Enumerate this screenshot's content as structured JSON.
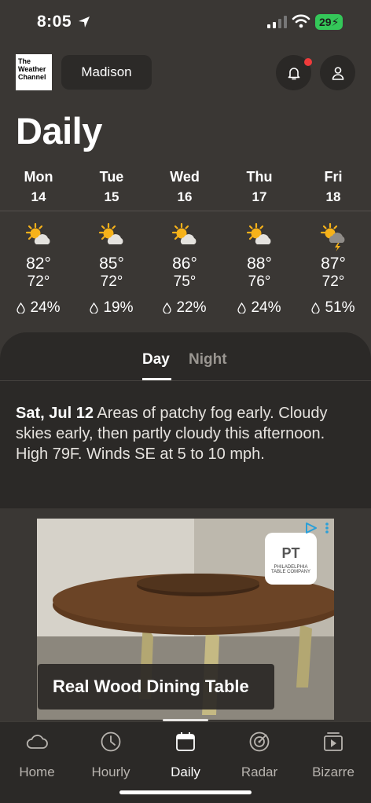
{
  "status_bar": {
    "time": "8:05",
    "battery": "29"
  },
  "header": {
    "logo_lines": [
      "The",
      "Weather",
      "Channel"
    ],
    "location": "Madison",
    "title": "Daily"
  },
  "days": [
    {
      "name": "Mon",
      "date": "14",
      "high": "82°",
      "low": "72°",
      "precip": "24%",
      "icon": "partly-sunny-icon"
    },
    {
      "name": "Tue",
      "date": "15",
      "high": "85°",
      "low": "72°",
      "precip": "19%",
      "icon": "partly-sunny-icon"
    },
    {
      "name": "Wed",
      "date": "16",
      "high": "86°",
      "low": "75°",
      "precip": "22%",
      "icon": "partly-sunny-icon"
    },
    {
      "name": "Thu",
      "date": "17",
      "high": "88°",
      "low": "76°",
      "precip": "24%",
      "icon": "partly-sunny-icon"
    },
    {
      "name": "Fri",
      "date": "18",
      "high": "87°",
      "low": "72°",
      "precip": "51%",
      "icon": "sun-thunderstorm-icon"
    }
  ],
  "detail": {
    "tabs": {
      "day": "Day",
      "night": "Night",
      "active": "Day"
    },
    "date": "Sat, Jul 12",
    "text": "Areas of patchy fog early. Cloudy skies early, then partly cloudy this afternoon. High 79F. Winds SE at 5 to 10 mph."
  },
  "ad": {
    "headline": "Real Wood Dining Table",
    "brand_text": "PHILADELPHIA TABLE COMPANY",
    "brand_mark": "PT"
  },
  "tabbar": {
    "items": [
      {
        "label": "Home",
        "icon": "cloud-icon"
      },
      {
        "label": "Hourly",
        "icon": "clock-icon"
      },
      {
        "label": "Daily",
        "icon": "calendar-icon"
      },
      {
        "label": "Radar",
        "icon": "radar-icon"
      },
      {
        "label": "Bizarre",
        "icon": "play-icon"
      }
    ],
    "active": "Daily"
  },
  "colors": {
    "background": "#3a3734",
    "panel": "#2b2927",
    "sun": "#f6b21a",
    "notification": "#ef3b3b",
    "battery": "#34c759"
  }
}
